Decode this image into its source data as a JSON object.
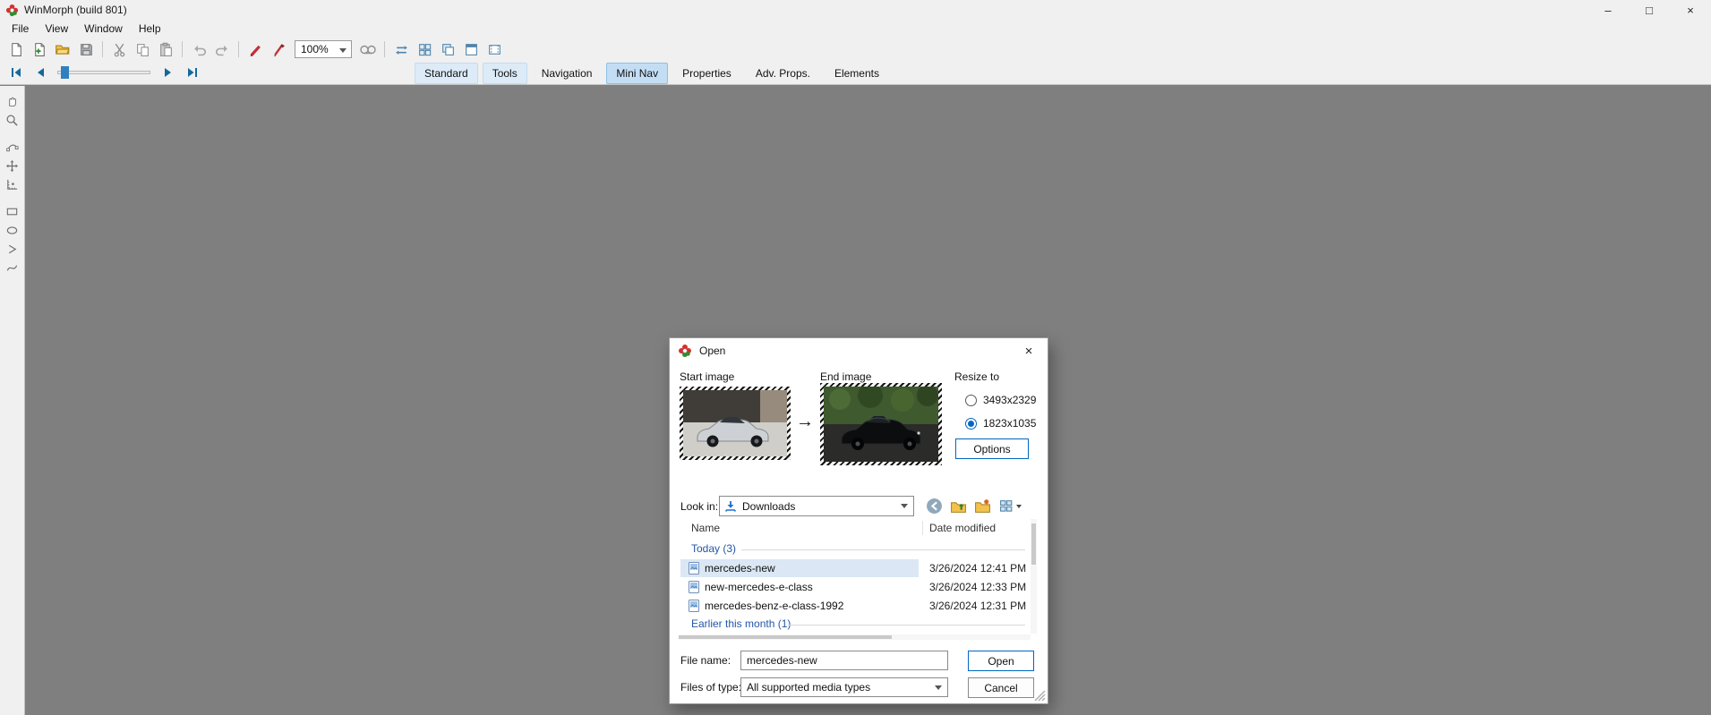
{
  "colors": {
    "accent": "#0067c0",
    "workspace": "#7f7f7f",
    "selection": "#dbe7f4",
    "group_text": "#2456a8",
    "tab_active": "#c3def4"
  },
  "window": {
    "title": "WinMorph (build 801)",
    "minimize_glyph": "–",
    "maximize_glyph": "□",
    "close_glyph": "×"
  },
  "menu": {
    "items": [
      "File",
      "View",
      "Window",
      "Help"
    ]
  },
  "toolbar": {
    "zoom_value": "100%",
    "icon_names": [
      "new-file",
      "new-project",
      "open-folder",
      "save",
      "cut",
      "copy",
      "paste",
      "undo",
      "redo",
      "render-marker",
      "preview-marker",
      "zoom-select",
      "movie",
      "swap",
      "grid",
      "overlay",
      "tile-window",
      "film-frame"
    ]
  },
  "transport": {
    "buttons": [
      "first-frame",
      "previous-frame",
      "next-frame",
      "last-frame"
    ],
    "slider": "frame-position"
  },
  "tabs": [
    {
      "label": "Standard",
      "state": "on"
    },
    {
      "label": "Tools",
      "state": "on"
    },
    {
      "label": "Navigation",
      "state": "off"
    },
    {
      "label": "Mini Nav",
      "state": "active"
    },
    {
      "label": "Properties",
      "state": "off"
    },
    {
      "label": "Adv. Props.",
      "state": "off"
    },
    {
      "label": "Elements",
      "state": "off"
    }
  ],
  "toolbox": {
    "tools": [
      "hand",
      "zoom",
      "node-edit",
      "move",
      "coordinates",
      "rectangle",
      "ellipse",
      "polyline",
      "curve"
    ]
  },
  "dialog": {
    "title": "Open",
    "close_glyph": "×",
    "start_image_label": "Start image",
    "end_image_label": "End image",
    "arrow_glyph": "→",
    "resize_label": "Resize to",
    "resize_options": [
      {
        "label": "3493x2329",
        "selected": false
      },
      {
        "label": "1823x1035",
        "selected": true
      }
    ],
    "options_button": "Options",
    "look_in_label": "Look in:",
    "look_in_value": "Downloads",
    "nav_icons": [
      "back",
      "up-one-level",
      "new-folder",
      "view-menu"
    ],
    "columns": {
      "name": "Name",
      "date": "Date modified"
    },
    "group_today": "Today (3)",
    "group_earlier": "Earlier this month (1)",
    "files": [
      {
        "name": "mercedes-new",
        "date": "3/26/2024 12:41 PM",
        "selected": true
      },
      {
        "name": "new-mercedes-e-class",
        "date": "3/26/2024 12:33 PM",
        "selected": false
      },
      {
        "name": "mercedes-benz-e-class-1992",
        "date": "3/26/2024 12:31 PM",
        "selected": false
      }
    ],
    "file_name_label": "File name:",
    "file_name_value": "mercedes-new",
    "files_of_type_label": "Files of type:",
    "files_of_type_value": "All supported media types",
    "open_button": "Open",
    "cancel_button": "Cancel"
  }
}
